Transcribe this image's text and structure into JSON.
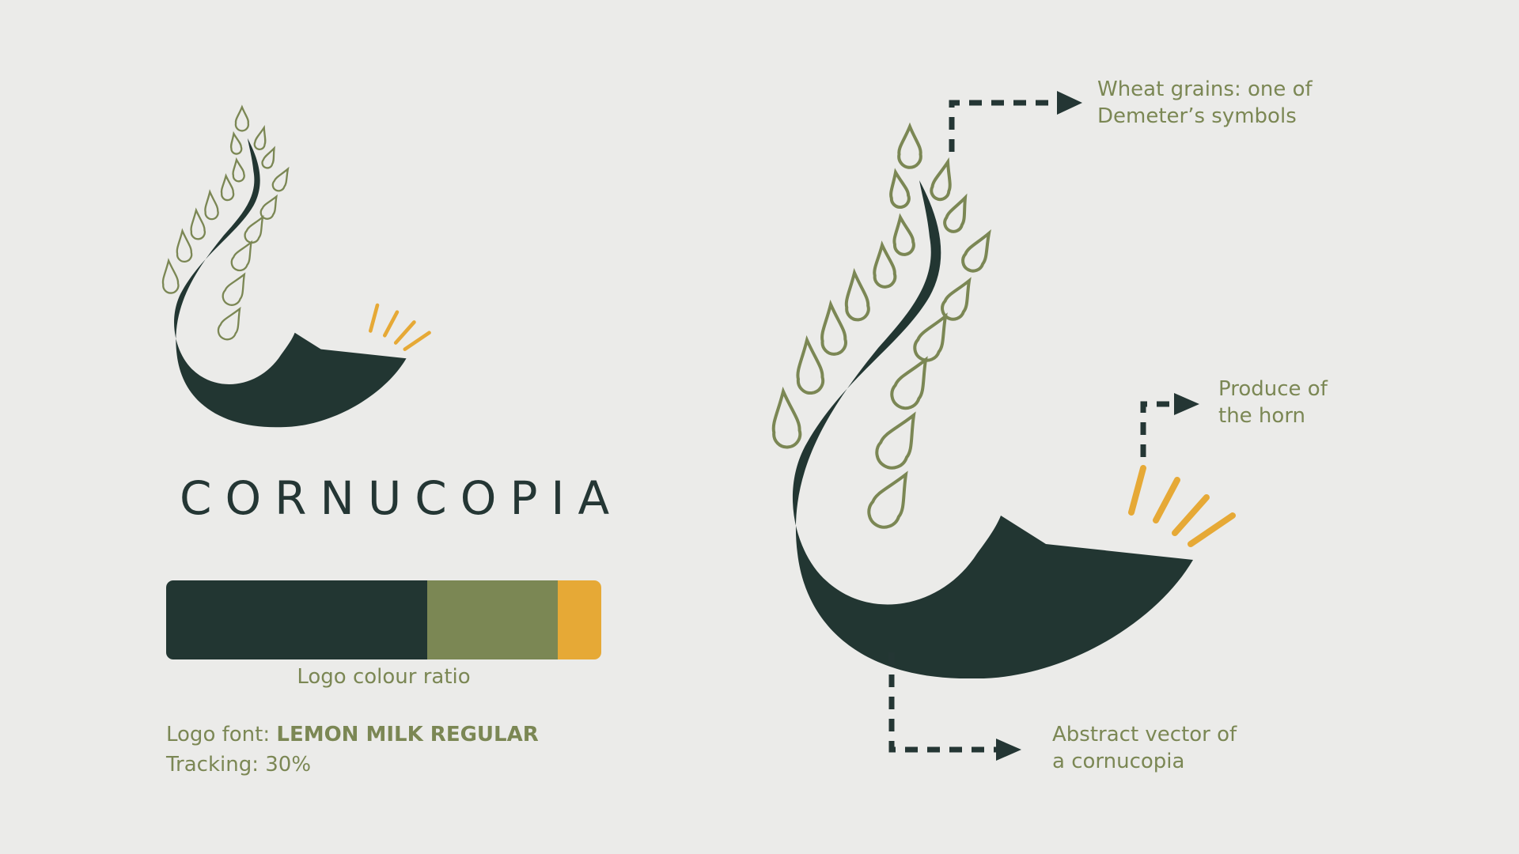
{
  "brand": {
    "name": "CORNUCOPIA"
  },
  "palette": {
    "dark": "#223632",
    "green": "#7b8754",
    "gold": "#e6a936",
    "background": "#ebebe9"
  },
  "colour_ratio": {
    "label": "Logo colour ratio",
    "segments": [
      {
        "color": "#223632",
        "fraction": 0.6
      },
      {
        "color": "#7b8754",
        "fraction": 0.3
      },
      {
        "color": "#e6a936",
        "fraction": 0.1
      }
    ]
  },
  "font_info": {
    "font_label": "Logo font:",
    "font_name": "LEMON MILK REGULAR",
    "tracking": "Tracking: 30%"
  },
  "annotations": {
    "wheat": {
      "line1": "Wheat grains: one of",
      "line2": "Demeter’s symbols"
    },
    "produce": {
      "line1": "Produce of",
      "line2": "the horn"
    },
    "horn": {
      "line1": "Abstract vector of",
      "line2": "a cornucopia"
    }
  }
}
